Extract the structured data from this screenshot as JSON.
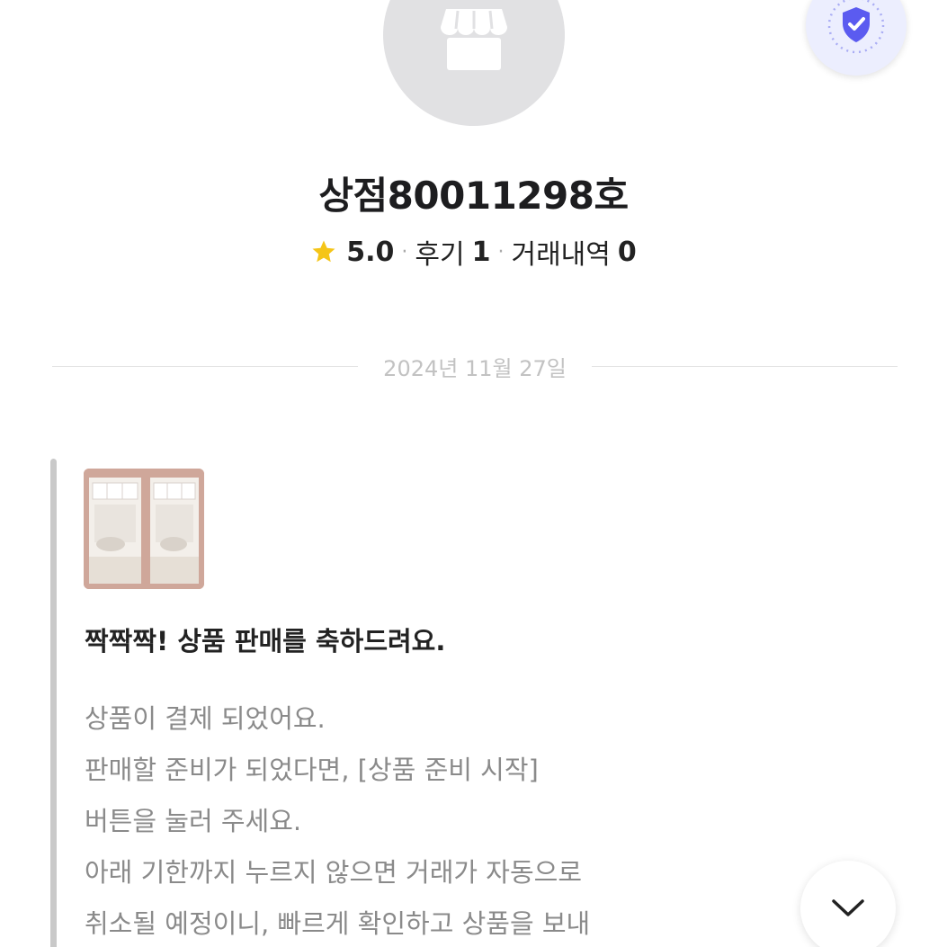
{
  "store": {
    "name": "상점80011298호",
    "avatar_icon": "store-icon",
    "verified_icon": "shield-check-icon",
    "rating": "5.0",
    "reviews_label": "후기",
    "reviews_count": "1",
    "transactions_label": "거래내역",
    "transactions_count": "0",
    "separator": "·"
  },
  "chat": {
    "date": "2024년 11월 27일",
    "message": {
      "title": "짝짝짝! 상품 판매를 축하드려요.",
      "lines": [
        "상품이 결제 되었어요.",
        "판매할 준비가 되었다면, [상품 준비 시작]",
        "버튼을 눌러 주세요.",
        "아래 기한까지 누르지 않으면 거래가 자동으로",
        "취소될 예정이니, 빠르게 확인하고 상품을 보내"
      ]
    }
  },
  "colors": {
    "accent": "#5b5bf0",
    "star": "#f5c518",
    "avatar_bg": "#e1e1e3"
  },
  "icons": {
    "rating": "star-icon",
    "scroll": "chevron-down-icon"
  }
}
